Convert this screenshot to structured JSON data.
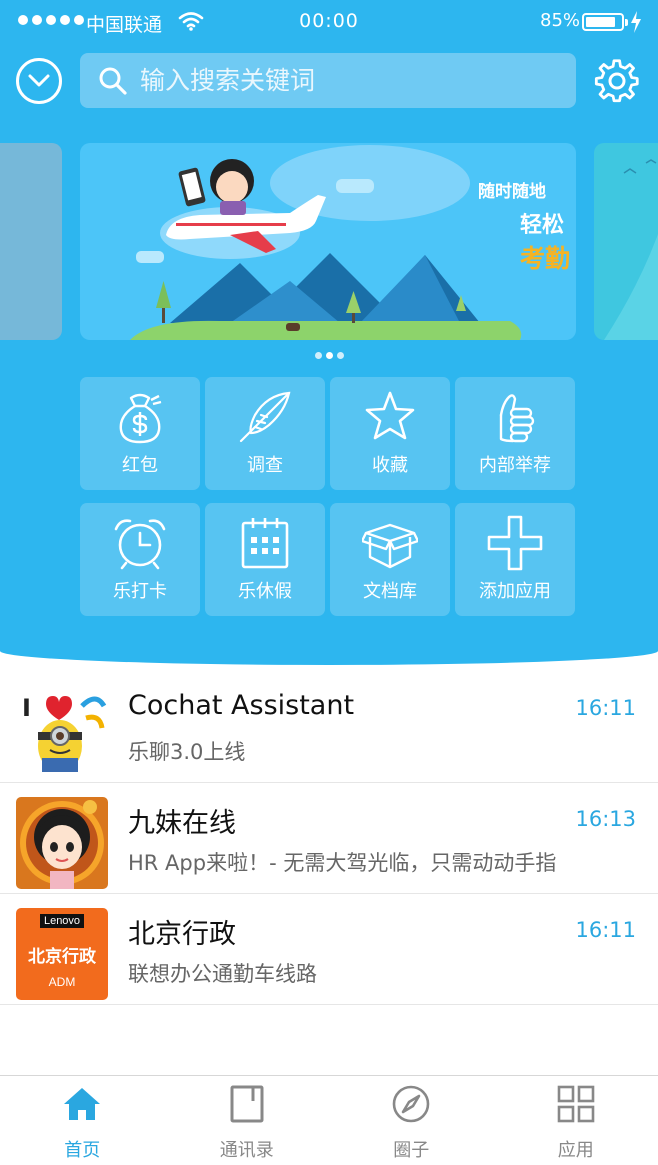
{
  "colors": {
    "primary": "#2db6ef",
    "tile": "#57c4f2",
    "accent_orange": "#f5b324",
    "active_tab": "#2aa7e0",
    "muted_text": "#888888"
  },
  "status_bar": {
    "carrier": "中国联通",
    "time": "00:00",
    "battery": "85%",
    "battery_level": 0.85
  },
  "search": {
    "placeholder": "输入搜索关键词"
  },
  "banner": {
    "line1": "随时随地",
    "line2_prefix": "轻松",
    "line2_accent": "考勤",
    "slide_count": 3,
    "active_slide": 1
  },
  "apps": [
    {
      "label": "红包",
      "icon": "money-bag-icon"
    },
    {
      "label": "调查",
      "icon": "feather-icon"
    },
    {
      "label": "收藏",
      "icon": "star-icon"
    },
    {
      "label": "内部举荐",
      "icon": "thumbs-up-icon"
    },
    {
      "label": "乐打卡",
      "icon": "alarm-clock-icon"
    },
    {
      "label": "乐休假",
      "icon": "calendar-icon"
    },
    {
      "label": "文档库",
      "icon": "box-icon"
    },
    {
      "label": "添加应用",
      "icon": "plus-icon"
    }
  ],
  "messages": [
    {
      "name": "Cochat Assistant",
      "time": "16:11",
      "preview": "乐聊3.0上线",
      "avatar_text": "I"
    },
    {
      "name": "九妹在线",
      "time": "16:13",
      "preview": "HR App来啦！- 无需大驾光临，只需动动手指"
    },
    {
      "name": "北京行政",
      "time": "16:11",
      "preview": "联想办公通勤车线路",
      "avatar_brand": "Lenovo",
      "avatar_title": "北京行政",
      "avatar_sub": "ADM"
    }
  ],
  "tabs": [
    {
      "label": "首页",
      "icon": "home-icon",
      "active": true
    },
    {
      "label": "通讯录",
      "icon": "contacts-icon",
      "active": false
    },
    {
      "label": "圈子",
      "icon": "compass-icon",
      "active": false
    },
    {
      "label": "应用",
      "icon": "apps-grid-icon",
      "active": false
    }
  ]
}
